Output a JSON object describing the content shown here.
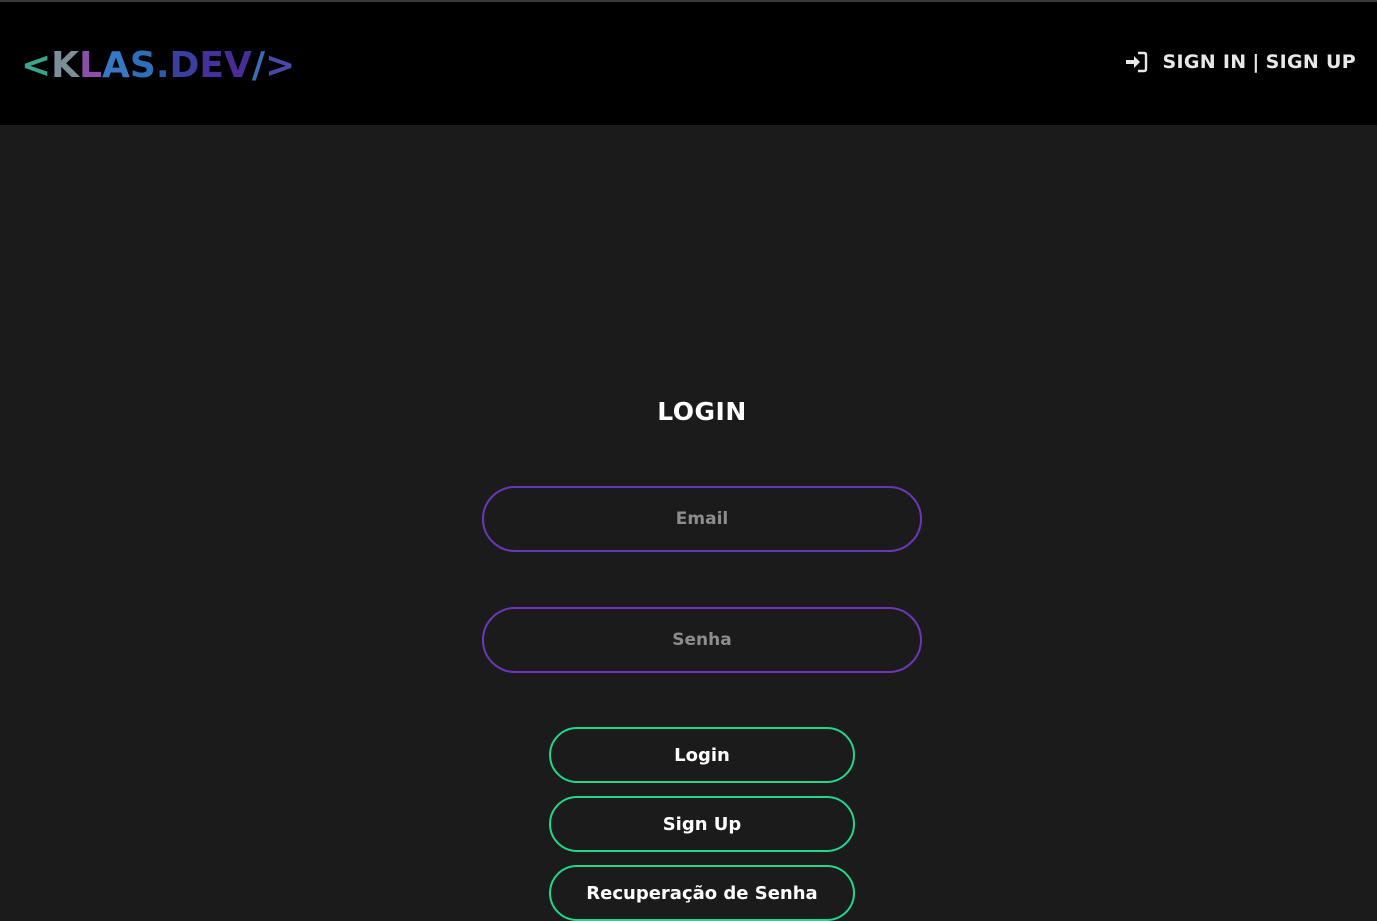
{
  "header": {
    "logo": {
      "parts": [
        {
          "text": "<",
          "color": "#3aa58a"
        },
        {
          "text": "K",
          "color": "#7a8f9a"
        },
        {
          "text": "L",
          "color": "#8a4fa8"
        },
        {
          "text": "A",
          "color": "#3777c4"
        },
        {
          "text": "S",
          "color": "#2f6fb8"
        },
        {
          "text": ".",
          "color": "#2f5ca8"
        },
        {
          "text": "D",
          "color": "#3b3fa0"
        },
        {
          "text": "E",
          "color": "#45319b"
        },
        {
          "text": "V",
          "color": "#4a2c95"
        },
        {
          "text": "/",
          "color": "#3b6fb5"
        },
        {
          "text": ">",
          "color": "#4a49a8"
        }
      ]
    },
    "auth": {
      "icon": "sign-in-icon",
      "sign_in": "SIGN IN",
      "separator": "|",
      "sign_up": "SIGN UP"
    }
  },
  "main": {
    "title": "LOGIN",
    "email_placeholder": "Email",
    "password_placeholder": "Senha",
    "login_button": "Login",
    "signup_button": "Sign Up",
    "recover_button": "Recuperação de Senha"
  },
  "colors": {
    "input_border": "#6a37b8",
    "button_border": "#1fd88a",
    "background": "#1b1b1c",
    "header_background": "#000000"
  }
}
